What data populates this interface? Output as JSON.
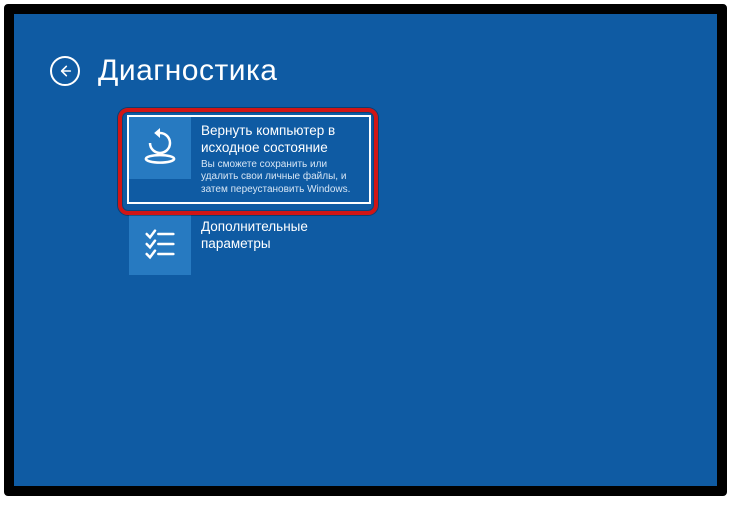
{
  "header": {
    "title": "Диагностика"
  },
  "options": {
    "reset": {
      "title": "Вернуть компьютер в исходное состояние",
      "desc": "Вы сможете сохранить или удалить свои личные файлы, и затем переустановить Windows."
    },
    "advanced": {
      "title": "Дополнительные параметры",
      "desc": ""
    }
  }
}
